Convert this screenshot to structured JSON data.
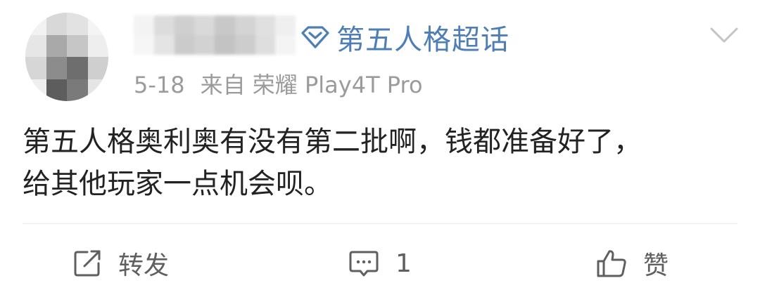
{
  "post": {
    "topic": "第五人格超话",
    "date": "5-18",
    "source": "来自 荣耀 Play4T Pro",
    "text_line1": "第五人格奥利奥有没有第二批啊，钱都准备好了，",
    "text_line2": "给其他玩家一点机会呗。"
  },
  "actions": {
    "repost_label": "转发",
    "comment_count": "1",
    "like_label": "赞"
  },
  "icons": {
    "topic": "diamond-icon",
    "menu": "chevron-down-icon",
    "repost": "share-icon",
    "comment": "comment-icon",
    "like": "thumbs-up-icon"
  },
  "colors": {
    "topic": "#4f7eb7",
    "text": "#222222",
    "meta": "#9b9b9b",
    "action": "#5f5f5f"
  }
}
